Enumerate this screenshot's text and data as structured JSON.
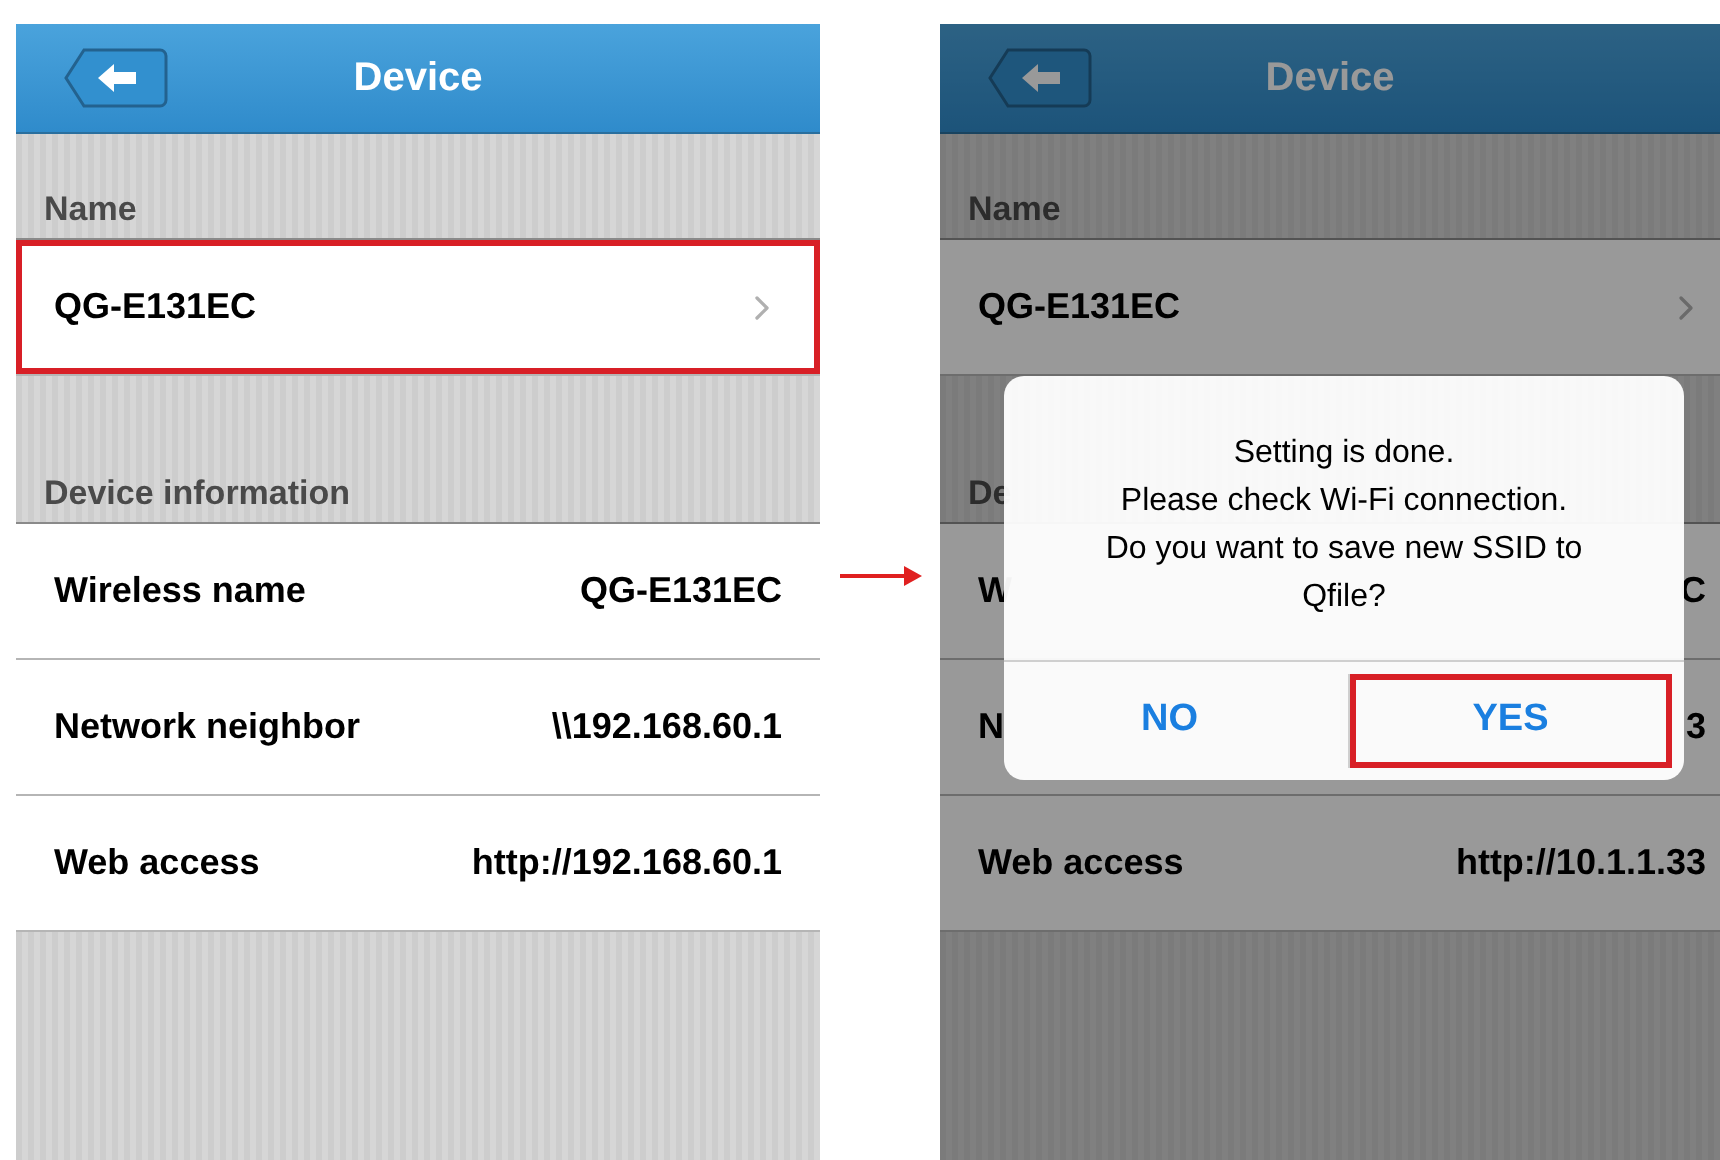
{
  "screens": [
    {
      "title": "Device",
      "dimmed": false,
      "sections": [
        {
          "header": "Name",
          "rows": [
            {
              "kind": "link",
              "label": "QG-E131EC",
              "highlighted": true
            }
          ]
        },
        {
          "header": "Device information",
          "rows": [
            {
              "kind": "info",
              "label": "Wireless name",
              "value": "QG-E131EC",
              "highlighted": false
            },
            {
              "kind": "info",
              "label": "Network neighbor",
              "value": "\\\\192.168.60.1",
              "highlighted": false
            },
            {
              "kind": "info",
              "label": "Web access",
              "value": "http://192.168.60.1",
              "highlighted": false
            }
          ]
        }
      ]
    },
    {
      "title": "Device",
      "dimmed": true,
      "sections": [
        {
          "header": "Name",
          "rows": [
            {
              "kind": "link",
              "label": "QG-E131EC",
              "highlighted": false
            }
          ]
        },
        {
          "header": "De",
          "rows": [
            {
              "kind": "info",
              "label": "W",
              "value": "C",
              "highlighted": false
            },
            {
              "kind": "info",
              "label": "N",
              "value": "3",
              "highlighted": false
            },
            {
              "kind": "info",
              "label": "Web access",
              "value": "http://10.1.1.33",
              "highlighted": false
            }
          ]
        }
      ],
      "dialog": {
        "message": "Setting is done.\nPlease check Wi-Fi connection.\nDo you want to save new SSID to\nQfile?",
        "buttons": [
          {
            "label": "NO",
            "highlighted": false
          },
          {
            "label": "YES",
            "highlighted": true
          }
        ]
      }
    }
  ]
}
